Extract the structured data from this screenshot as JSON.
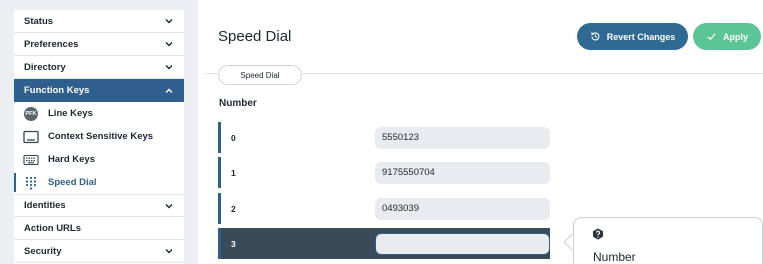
{
  "sidebar": {
    "items": [
      {
        "label": "Status",
        "expanded": false
      },
      {
        "label": "Preferences",
        "expanded": false
      },
      {
        "label": "Directory",
        "expanded": false
      },
      {
        "label": "Function Keys",
        "expanded": true
      },
      {
        "label": "Identities",
        "expanded": false
      },
      {
        "label": "Action URLs"
      },
      {
        "label": "Security",
        "expanded": false
      }
    ],
    "function_keys": [
      {
        "label": "Line Keys",
        "icon": "pfk-icon",
        "badge": "PFK"
      },
      {
        "label": "Context Sensitive Keys",
        "icon": "context-key-icon"
      },
      {
        "label": "Hard Keys",
        "icon": "keyboard-icon"
      },
      {
        "label": "Speed Dial",
        "icon": "keypad-icon",
        "current": true
      }
    ]
  },
  "header": {
    "title": "Speed Dial",
    "revert_label": "Revert Changes",
    "apply_label": "Apply"
  },
  "tabs": [
    {
      "label": "Speed Dial"
    }
  ],
  "section": {
    "label": "Number"
  },
  "speed_dial": [
    {
      "index": "0",
      "value": "5550123"
    },
    {
      "index": "1",
      "value": "9175550704"
    },
    {
      "index": "2",
      "value": "0493039"
    },
    {
      "index": "3",
      "value": "",
      "selected": true
    }
  ],
  "tooltip": {
    "title": "Number",
    "icon": "help-icon"
  },
  "colors": {
    "accent": "#2f5f8c",
    "revert": "#2f6a92",
    "apply": "#5cc597",
    "selected_row": "#394b59"
  }
}
